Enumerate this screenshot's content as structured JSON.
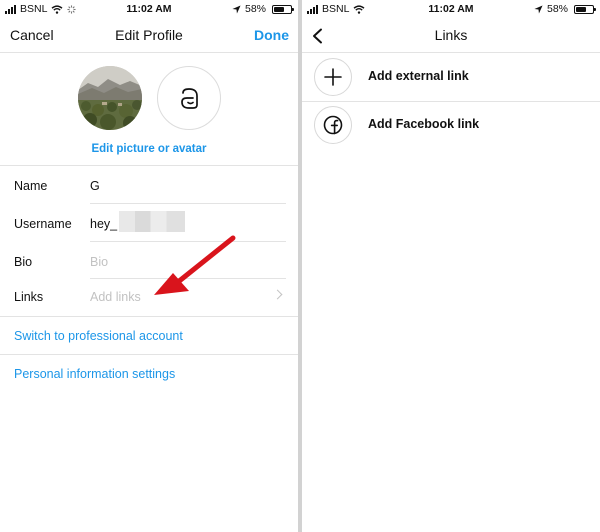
{
  "status_bar": {
    "carrier": "BSNL",
    "time": "11:02 AM",
    "battery": "58%"
  },
  "edit_profile": {
    "nav": {
      "cancel": "Cancel",
      "title": "Edit Profile",
      "done": "Done"
    },
    "edit_picture_label": "Edit picture or avatar",
    "fields": {
      "name": {
        "label": "Name",
        "value": "G"
      },
      "username": {
        "label": "Username",
        "value": "hey_"
      },
      "bio": {
        "label": "Bio",
        "placeholder": "Bio"
      },
      "links": {
        "label": "Links",
        "placeholder": "Add links"
      }
    },
    "switch_account": "Switch to professional account",
    "personal_info": "Personal information settings"
  },
  "links_screen": {
    "title": "Links",
    "items": [
      {
        "label": "Add external link",
        "icon": "plus-icon"
      },
      {
        "label": "Add Facebook link",
        "icon": "facebook-icon"
      }
    ]
  },
  "colors": {
    "accent": "#1c96e8",
    "annotation_arrow": "#d9141c",
    "placeholder": "#c2c2c2"
  }
}
